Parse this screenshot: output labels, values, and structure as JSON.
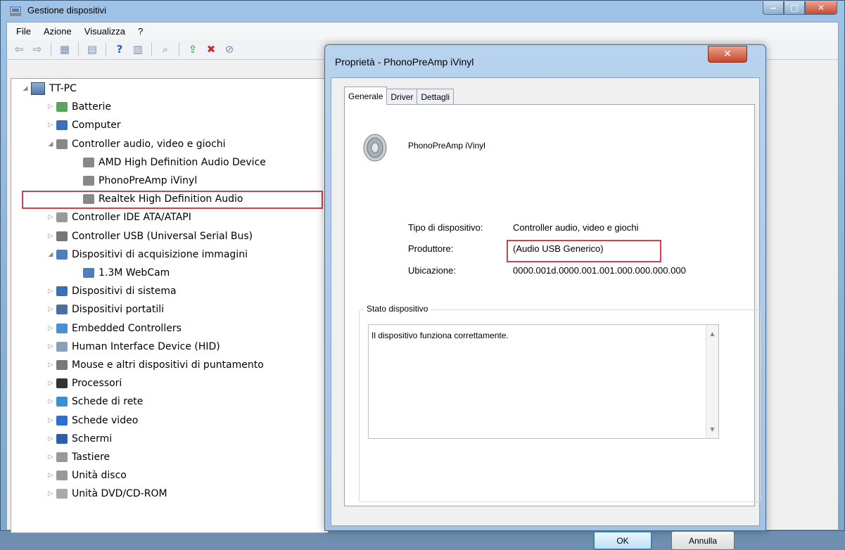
{
  "window": {
    "title": "Gestione dispositivi",
    "controls": {
      "minimize": "‒",
      "maximize": "□",
      "close": "✕"
    }
  },
  "menu": [
    "File",
    "Azione",
    "Visualizza",
    "?"
  ],
  "toolbar": {
    "icons": [
      "back-arrow-icon",
      "forward-arrow-icon",
      "view-icon",
      "properties-icon",
      "help-icon",
      "view-resources-icon",
      "scan-hardware-icon",
      "update-driver-icon",
      "uninstall-icon",
      "disable-icon"
    ]
  },
  "tree": {
    "root": "TT-PC",
    "items": [
      {
        "label": "Batterie",
        "level": 1,
        "exp": "▷"
      },
      {
        "label": "Computer",
        "level": 1,
        "exp": "▷"
      },
      {
        "label": "Controller audio, video e giochi",
        "level": 1,
        "exp": "◢"
      },
      {
        "label": "AMD High Definition Audio Device",
        "level": 2,
        "exp": ""
      },
      {
        "label": "PhonoPreAmp iVinyl",
        "level": 2,
        "exp": ""
      },
      {
        "label": "Realtek High Definition Audio",
        "level": 2,
        "exp": ""
      },
      {
        "label": "Controller IDE ATA/ATAPI",
        "level": 1,
        "exp": "▷"
      },
      {
        "label": "Controller USB (Universal Serial Bus)",
        "level": 1,
        "exp": "▷"
      },
      {
        "label": "Dispositivi di acquisizione immagini",
        "level": 1,
        "exp": "◢"
      },
      {
        "label": "1.3M WebCam",
        "level": 2,
        "exp": ""
      },
      {
        "label": "Dispositivi di sistema",
        "level": 1,
        "exp": "▷"
      },
      {
        "label": "Dispositivi portatili",
        "level": 1,
        "exp": "▷"
      },
      {
        "label": "Embedded Controllers",
        "level": 1,
        "exp": "▷"
      },
      {
        "label": "Human Interface Device (HID)",
        "level": 1,
        "exp": "▷"
      },
      {
        "label": "Mouse e altri dispositivi di puntamento",
        "level": 1,
        "exp": "▷"
      },
      {
        "label": "Processori",
        "level": 1,
        "exp": "▷"
      },
      {
        "label": "Schede di rete",
        "level": 1,
        "exp": "▷"
      },
      {
        "label": "Schede video",
        "level": 1,
        "exp": "▷"
      },
      {
        "label": "Schermi",
        "level": 1,
        "exp": "▷"
      },
      {
        "label": "Tastiere",
        "level": 1,
        "exp": "▷"
      },
      {
        "label": "Unità disco",
        "level": 1,
        "exp": "▷"
      },
      {
        "label": "Unità DVD/CD-ROM",
        "level": 1,
        "exp": "▷"
      }
    ]
  },
  "dialog": {
    "title": "Proprietà - PhonoPreAmp iVinyl",
    "close": "✕",
    "tabs": [
      "Generale",
      "Driver",
      "Dettagli"
    ],
    "device_name": "PhonoPreAmp iVinyl",
    "props": {
      "type_label": "Tipo di dispositivo:",
      "type_value": "Controller audio, video e giochi",
      "manufacturer_label": "Produttore:",
      "manufacturer_value": "(Audio USB Generico)",
      "location_label": "Ubicazione:",
      "location_value": "0000.001d.0000.001.001.000.000.000.000"
    },
    "status_group": "Stato dispositivo",
    "status_text": "Il dispositivo funziona correttamente.",
    "ok": "OK",
    "cancel": "Annulla"
  }
}
